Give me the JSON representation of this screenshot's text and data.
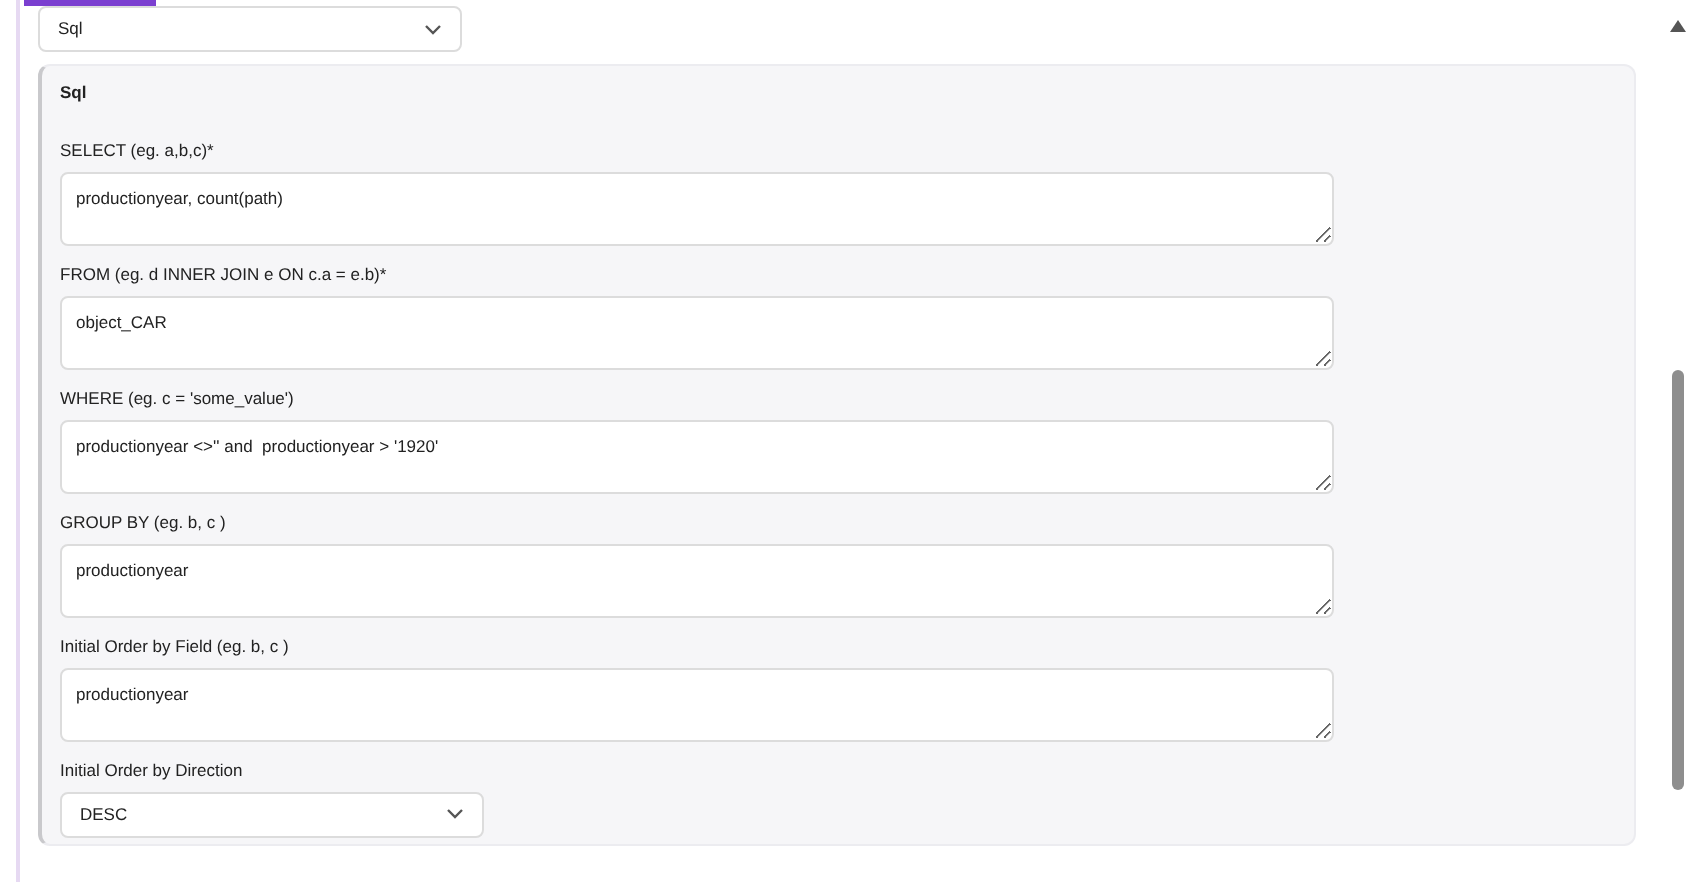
{
  "query_type_select": {
    "value": "Sql"
  },
  "panel": {
    "title": "Sql",
    "fields": [
      {
        "kind": "textarea",
        "label": "SELECT (eg. a,b,c)*",
        "value": "productionyear, count(path)"
      },
      {
        "kind": "textarea",
        "label": "FROM (eg. d INNER JOIN e ON c.a = e.b)*",
        "value": "object_CAR"
      },
      {
        "kind": "textarea",
        "label": "WHERE (eg. c = 'some_value')",
        "value": "productionyear <>'' and  productionyear > '1920'"
      },
      {
        "kind": "textarea",
        "label": "GROUP BY (eg. b, c )",
        "value": "productionyear"
      },
      {
        "kind": "textarea",
        "label": "Initial Order by Field (eg. b, c )",
        "value": "productionyear"
      },
      {
        "kind": "select",
        "label": "Initial Order by Direction",
        "value": "DESC"
      }
    ]
  }
}
